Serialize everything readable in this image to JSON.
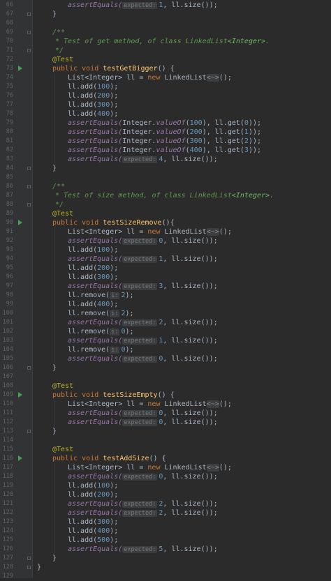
{
  "line_numbers": [
    "66",
    "67",
    "68",
    "69",
    "70",
    "71",
    "72",
    "73",
    "74",
    "75",
    "76",
    "77",
    "78",
    "79",
    "80",
    "81",
    "82",
    "83",
    "84",
    "85",
    "86",
    "87",
    "88",
    "89",
    "90",
    "91",
    "92",
    "93",
    "94",
    "95",
    "96",
    "97",
    "98",
    "99",
    "100",
    "101",
    "102",
    "103",
    "104",
    "105",
    "106",
    "107",
    "108",
    "109",
    "110",
    "111",
    "112",
    "113",
    "114",
    "115",
    "116",
    "117",
    "118",
    "119",
    "120",
    "121",
    "122",
    "123",
    "124",
    "125",
    "126",
    "127",
    "128",
    "129"
  ],
  "editor": {
    "colors": {
      "background": "#2b2b2b",
      "gutter": "#313335",
      "keyword": "#cc7832",
      "method_name": "#ffc66d",
      "static_call": "#9876aa",
      "number": "#6897bb",
      "doc_comment": "#629755",
      "annotation": "#bbb529",
      "run_marker": "#499c54"
    },
    "gutter_icons": [
      "run-test-icon",
      "fold-icon"
    ]
  },
  "code": {
    "assert_equals": "assertEquals(",
    "ll_size": "ll.size());",
    "expected_hint": "expected:",
    "index_hint": "i:",
    "close_brace": "}",
    "doc_open": "/**",
    "doc_close": "*/",
    "annotation_test": "@Test",
    "kw_public": "public",
    "kw_void": "void",
    "kw_new": "new",
    "list_decl": "List<Integer> ll =",
    "linked_list": "LinkedList",
    "diamond": "<~>",
    "decl_end": "();",
    "ll_add": "ll.add(",
    "ll_remove": "ll.remove(",
    "ll_get": "ll.get(",
    "integer_prefix": "Integer.",
    "value_of": "valueOf",
    "call_end": ");",
    "methods": {
      "get_bigger": "testGetBigger",
      "size_remove": "testSizeRemove",
      "size_empty": "testSizeEmpty",
      "add_size": "testAddSize"
    },
    "method_sig_end": "() {",
    "method_sig_end_tight": "(){",
    "get_doc_text": "* Test of get method, of class LinkedList",
    "size_doc_text": "* Test of size method, of class LinkedList",
    "generic_integer": "<Integer>",
    "doc_period": "."
  }
}
